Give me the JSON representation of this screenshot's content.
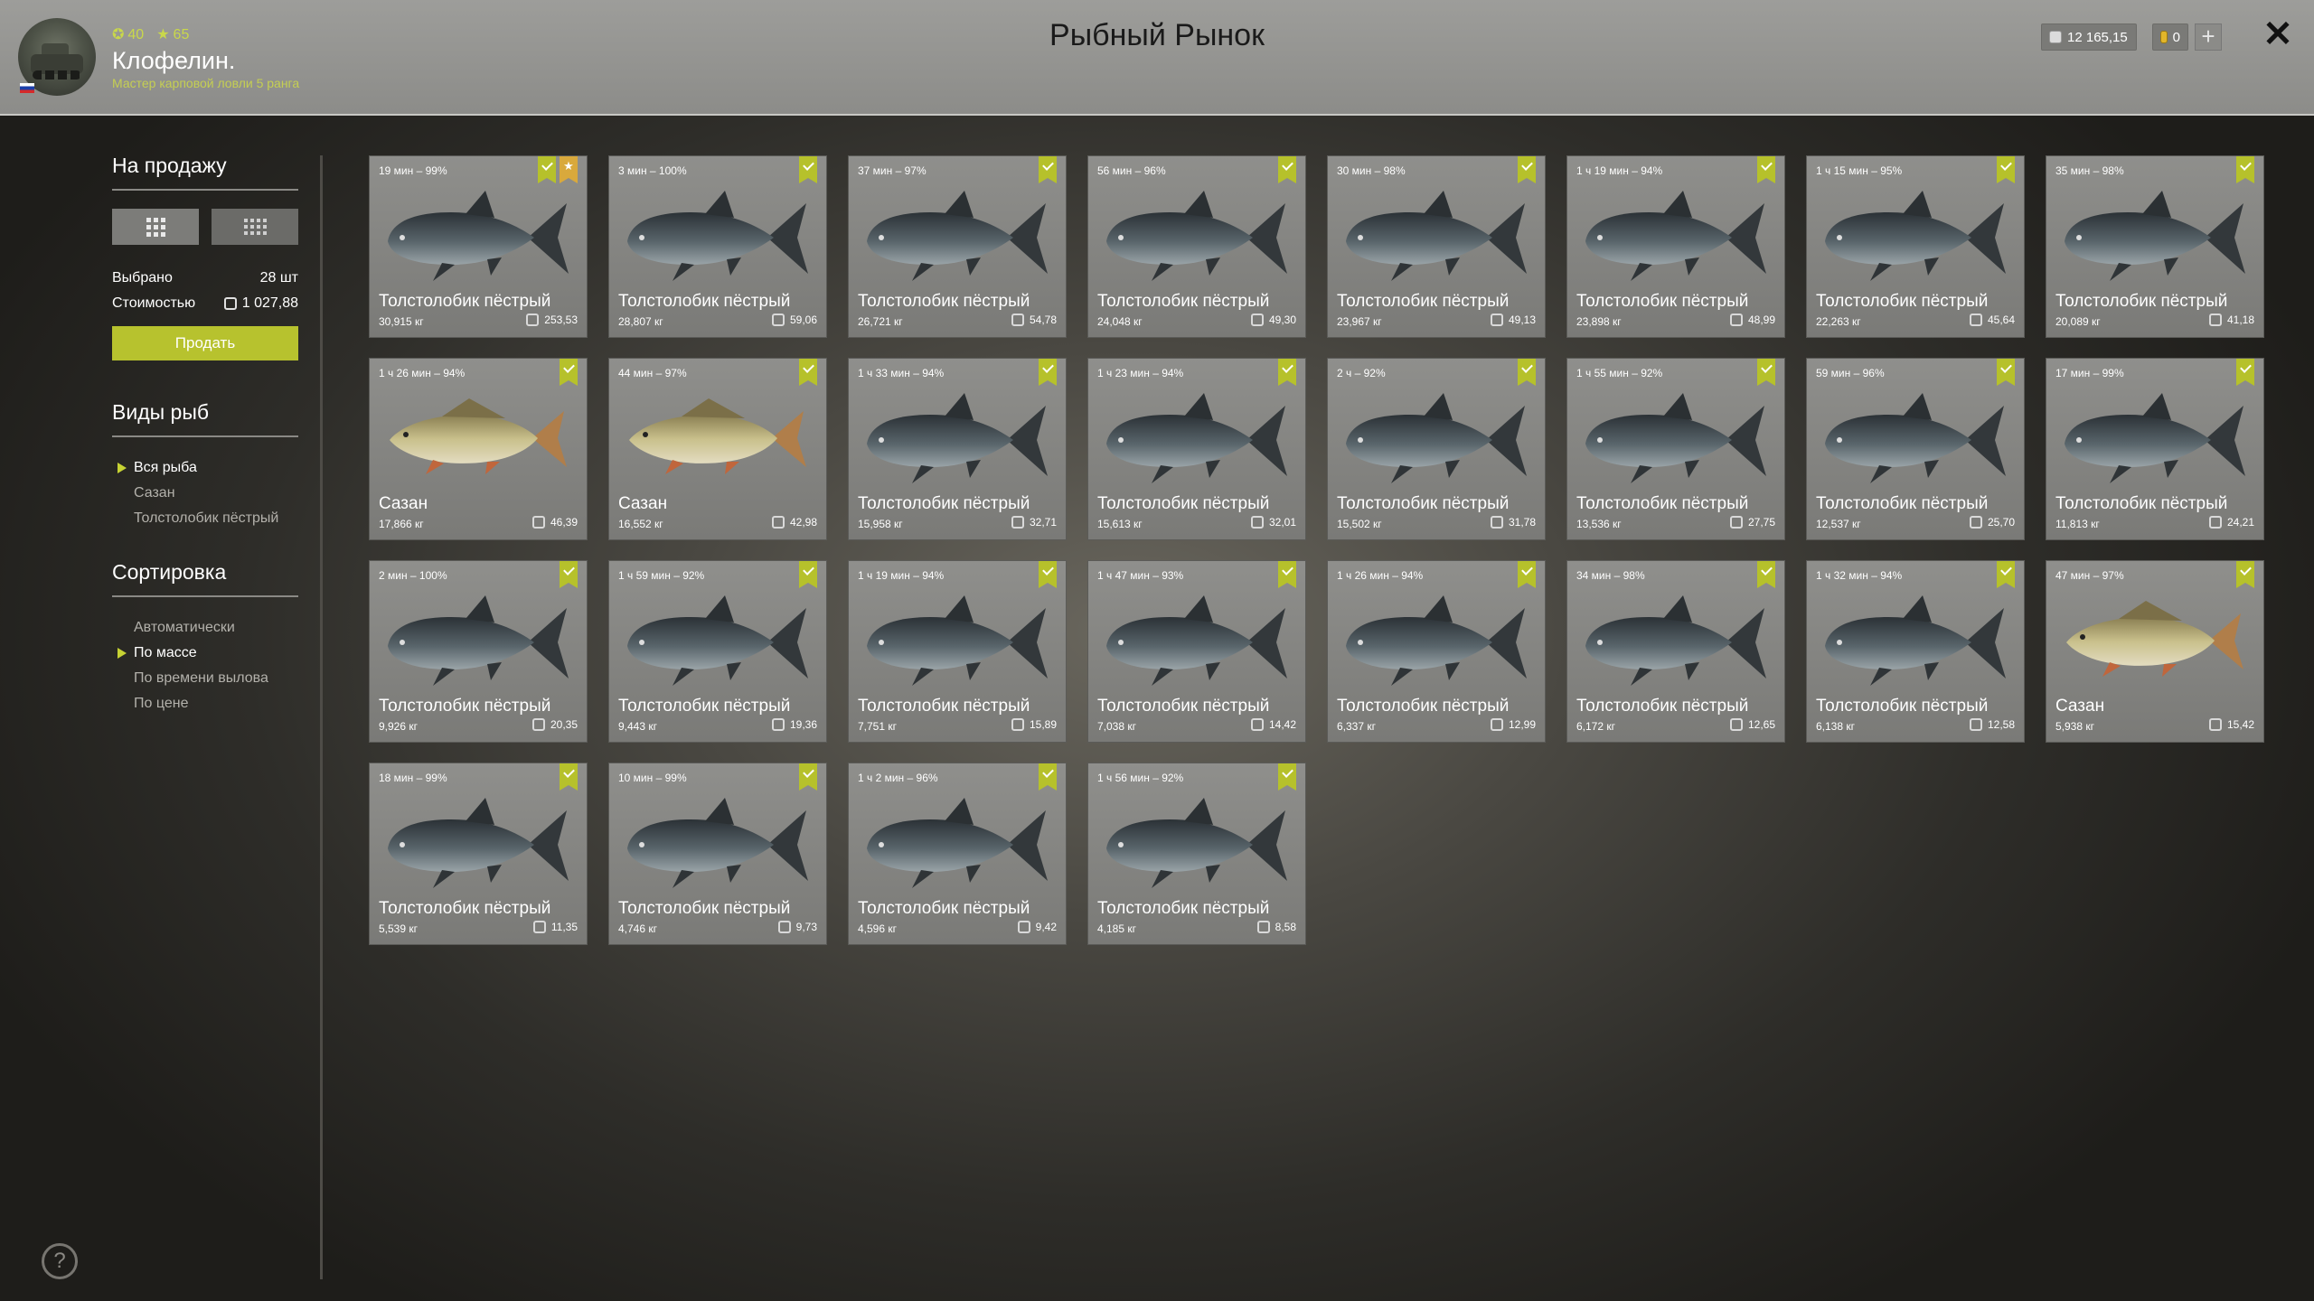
{
  "header": {
    "title": "Рыбный Рынок",
    "player": {
      "level": "40",
      "stars": "65",
      "name": "Клофелин.",
      "rank": "Мастер карповой ловли 5 ранга"
    },
    "currency": {
      "silver": "12 165,15",
      "gold": "0",
      "add_label": "+"
    },
    "close_label": "✕"
  },
  "sidebar": {
    "sale": {
      "title": "На продажу",
      "selected_label": "Выбрано",
      "selected_value": "28 шт",
      "cost_label": "Стоимостью",
      "cost_value": "1 027,88",
      "sell_button": "Продать"
    },
    "species": {
      "title": "Виды рыб",
      "items": [
        "Вся рыба",
        "Сазан",
        "Толстолобик пёстрый"
      ],
      "selected": 0
    },
    "sorting": {
      "title": "Сортировка",
      "items": [
        "Автоматически",
        "По массе",
        "По времени вылова",
        "По цене"
      ],
      "selected": 1
    },
    "help_label": "?"
  },
  "fish": [
    {
      "time": "19 мин – 99%",
      "name": "Толстолобик пёстрый",
      "weight": "30,915 кг",
      "price": "253,53",
      "kind": "carp_silver",
      "star": true
    },
    {
      "time": "3 мин – 100%",
      "name": "Толстолобик пёстрый",
      "weight": "28,807 кг",
      "price": "59,06",
      "kind": "carp_silver",
      "star": false
    },
    {
      "time": "37 мин – 97%",
      "name": "Толстолобик пёстрый",
      "weight": "26,721 кг",
      "price": "54,78",
      "kind": "carp_silver",
      "star": false
    },
    {
      "time": "56 мин – 96%",
      "name": "Толстолобик пёстрый",
      "weight": "24,048 кг",
      "price": "49,30",
      "kind": "carp_silver",
      "star": false
    },
    {
      "time": "30 мин – 98%",
      "name": "Толстолобик пёстрый",
      "weight": "23,967 кг",
      "price": "49,13",
      "kind": "carp_silver",
      "star": false
    },
    {
      "time": "1 ч 19 мин – 94%",
      "name": "Толстолобик пёстрый",
      "weight": "23,898 кг",
      "price": "48,99",
      "kind": "carp_silver",
      "star": false
    },
    {
      "time": "1 ч 15 мин – 95%",
      "name": "Толстолобик пёстрый",
      "weight": "22,263 кг",
      "price": "45,64",
      "kind": "carp_silver",
      "star": false
    },
    {
      "time": "35 мин – 98%",
      "name": "Толстолобик пёстрый",
      "weight": "20,089 кг",
      "price": "41,18",
      "kind": "carp_silver",
      "star": false
    },
    {
      "time": "1 ч 26 мин – 94%",
      "name": "Сазан",
      "weight": "17,866 кг",
      "price": "46,39",
      "kind": "sazan",
      "star": false
    },
    {
      "time": "44 мин – 97%",
      "name": "Сазан",
      "weight": "16,552 кг",
      "price": "42,98",
      "kind": "sazan",
      "star": false
    },
    {
      "time": "1 ч 33 мин – 94%",
      "name": "Толстолобик пёстрый",
      "weight": "15,958 кг",
      "price": "32,71",
      "kind": "carp_silver",
      "star": false
    },
    {
      "time": "1 ч 23 мин – 94%",
      "name": "Толстолобик пёстрый",
      "weight": "15,613 кг",
      "price": "32,01",
      "kind": "carp_silver",
      "star": false
    },
    {
      "time": "2 ч – 92%",
      "name": "Толстолобик пёстрый",
      "weight": "15,502 кг",
      "price": "31,78",
      "kind": "carp_silver",
      "star": false
    },
    {
      "time": "1 ч 55 мин – 92%",
      "name": "Толстолобик пёстрый",
      "weight": "13,536 кг",
      "price": "27,75",
      "kind": "carp_silver",
      "star": false
    },
    {
      "time": "59 мин – 96%",
      "name": "Толстолобик пёстрый",
      "weight": "12,537 кг",
      "price": "25,70",
      "kind": "carp_silver",
      "star": false
    },
    {
      "time": "17 мин – 99%",
      "name": "Толстолобик пёстрый",
      "weight": "11,813 кг",
      "price": "24,21",
      "kind": "carp_silver",
      "star": false
    },
    {
      "time": "2 мин – 100%",
      "name": "Толстолобик пёстрый",
      "weight": "9,926 кг",
      "price": "20,35",
      "kind": "carp_silver",
      "star": false
    },
    {
      "time": "1 ч 59 мин – 92%",
      "name": "Толстолобик пёстрый",
      "weight": "9,443 кг",
      "price": "19,36",
      "kind": "carp_silver",
      "star": false
    },
    {
      "time": "1 ч 19 мин – 94%",
      "name": "Толстолобик пёстрый",
      "weight": "7,751 кг",
      "price": "15,89",
      "kind": "carp_silver",
      "star": false
    },
    {
      "time": "1 ч 47 мин – 93%",
      "name": "Толстолобик пёстрый",
      "weight": "7,038 кг",
      "price": "14,42",
      "kind": "carp_silver",
      "star": false
    },
    {
      "time": "1 ч 26 мин – 94%",
      "name": "Толстолобик пёстрый",
      "weight": "6,337 кг",
      "price": "12,99",
      "kind": "carp_silver",
      "star": false
    },
    {
      "time": "34 мин – 98%",
      "name": "Толстолобик пёстрый",
      "weight": "6,172 кг",
      "price": "12,65",
      "kind": "carp_silver",
      "star": false
    },
    {
      "time": "1 ч 32 мин – 94%",
      "name": "Толстолобик пёстрый",
      "weight": "6,138 кг",
      "price": "12,58",
      "kind": "carp_silver",
      "star": false
    },
    {
      "time": "47 мин – 97%",
      "name": "Сазан",
      "weight": "5,938 кг",
      "price": "15,42",
      "kind": "sazan",
      "star": false
    },
    {
      "time": "18 мин – 99%",
      "name": "Толстолобик пёстрый",
      "weight": "5,539 кг",
      "price": "11,35",
      "kind": "carp_silver",
      "star": false
    },
    {
      "time": "10 мин – 99%",
      "name": "Толстолобик пёстрый",
      "weight": "4,746 кг",
      "price": "9,73",
      "kind": "carp_silver",
      "star": false
    },
    {
      "time": "1 ч 2 мин – 96%",
      "name": "Толстолобик пёстрый",
      "weight": "4,596 кг",
      "price": "9,42",
      "kind": "carp_silver",
      "star": false
    },
    {
      "time": "1 ч 56 мин – 92%",
      "name": "Толстолобик пёстрый",
      "weight": "4,185 кг",
      "price": "8,58",
      "kind": "carp_silver",
      "star": false
    }
  ],
  "colors": {
    "accent": "#b6c12b",
    "star": "#d9a93c"
  }
}
